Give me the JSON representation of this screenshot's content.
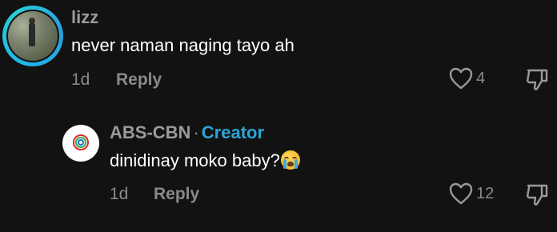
{
  "comments": [
    {
      "username": "lizz",
      "text": "never naman naging tayo ah",
      "time": "1d",
      "reply_label": "Reply",
      "like_count": "4",
      "avatar_ring_color": "#1fb6e8",
      "icons": {
        "like": "heart-outline-icon",
        "dislike": "thumbs-down-icon"
      }
    }
  ],
  "replies": [
    {
      "username": "ABS-CBN",
      "separator": "·",
      "badge": "Creator",
      "text": "dinidinay moko baby?",
      "emoji": "loudly-crying-face-emoji",
      "time": "1d",
      "reply_label": "Reply",
      "like_count": "12",
      "badge_color": "#2aa6d8",
      "icons": {
        "like": "heart-outline-icon",
        "dislike": "thumbs-down-icon"
      }
    }
  ],
  "colors": {
    "background": "#121212",
    "muted_text": "#8a8a8a",
    "username_text": "#9b9b9b",
    "body_text": "#ffffff"
  }
}
